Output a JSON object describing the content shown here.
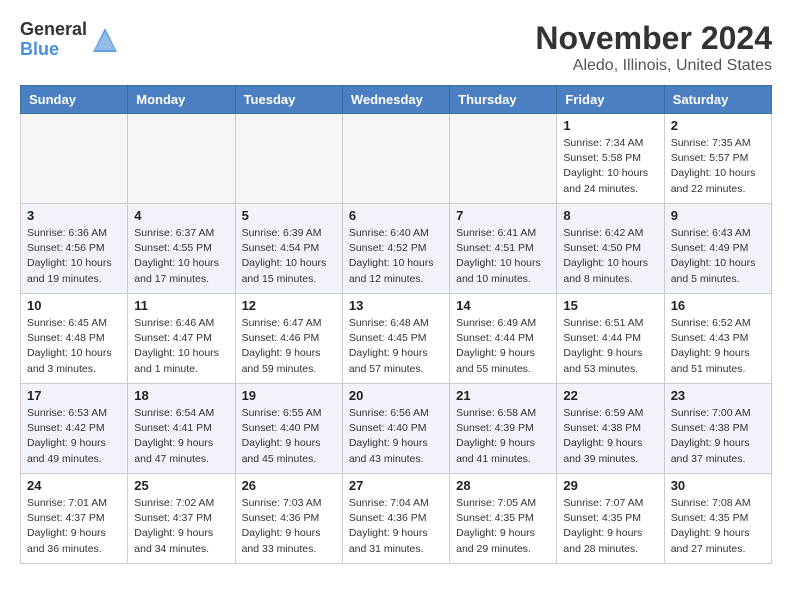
{
  "logo": {
    "text_general": "General",
    "text_blue": "Blue",
    "tagline": "GeneralBlue"
  },
  "header": {
    "month_title": "November 2024",
    "location": "Aledo, Illinois, United States"
  },
  "weekdays": [
    "Sunday",
    "Monday",
    "Tuesday",
    "Wednesday",
    "Thursday",
    "Friday",
    "Saturday"
  ],
  "weeks": [
    [
      {
        "day": "",
        "info": ""
      },
      {
        "day": "",
        "info": ""
      },
      {
        "day": "",
        "info": ""
      },
      {
        "day": "",
        "info": ""
      },
      {
        "day": "",
        "info": ""
      },
      {
        "day": "1",
        "info": "Sunrise: 7:34 AM\nSunset: 5:58 PM\nDaylight: 10 hours\nand 24 minutes."
      },
      {
        "day": "2",
        "info": "Sunrise: 7:35 AM\nSunset: 5:57 PM\nDaylight: 10 hours\nand 22 minutes."
      }
    ],
    [
      {
        "day": "3",
        "info": "Sunrise: 6:36 AM\nSunset: 4:56 PM\nDaylight: 10 hours\nand 19 minutes."
      },
      {
        "day": "4",
        "info": "Sunrise: 6:37 AM\nSunset: 4:55 PM\nDaylight: 10 hours\nand 17 minutes."
      },
      {
        "day": "5",
        "info": "Sunrise: 6:39 AM\nSunset: 4:54 PM\nDaylight: 10 hours\nand 15 minutes."
      },
      {
        "day": "6",
        "info": "Sunrise: 6:40 AM\nSunset: 4:52 PM\nDaylight: 10 hours\nand 12 minutes."
      },
      {
        "day": "7",
        "info": "Sunrise: 6:41 AM\nSunset: 4:51 PM\nDaylight: 10 hours\nand 10 minutes."
      },
      {
        "day": "8",
        "info": "Sunrise: 6:42 AM\nSunset: 4:50 PM\nDaylight: 10 hours\nand 8 minutes."
      },
      {
        "day": "9",
        "info": "Sunrise: 6:43 AM\nSunset: 4:49 PM\nDaylight: 10 hours\nand 5 minutes."
      }
    ],
    [
      {
        "day": "10",
        "info": "Sunrise: 6:45 AM\nSunset: 4:48 PM\nDaylight: 10 hours\nand 3 minutes."
      },
      {
        "day": "11",
        "info": "Sunrise: 6:46 AM\nSunset: 4:47 PM\nDaylight: 10 hours\nand 1 minute."
      },
      {
        "day": "12",
        "info": "Sunrise: 6:47 AM\nSunset: 4:46 PM\nDaylight: 9 hours\nand 59 minutes."
      },
      {
        "day": "13",
        "info": "Sunrise: 6:48 AM\nSunset: 4:45 PM\nDaylight: 9 hours\nand 57 minutes."
      },
      {
        "day": "14",
        "info": "Sunrise: 6:49 AM\nSunset: 4:44 PM\nDaylight: 9 hours\nand 55 minutes."
      },
      {
        "day": "15",
        "info": "Sunrise: 6:51 AM\nSunset: 4:44 PM\nDaylight: 9 hours\nand 53 minutes."
      },
      {
        "day": "16",
        "info": "Sunrise: 6:52 AM\nSunset: 4:43 PM\nDaylight: 9 hours\nand 51 minutes."
      }
    ],
    [
      {
        "day": "17",
        "info": "Sunrise: 6:53 AM\nSunset: 4:42 PM\nDaylight: 9 hours\nand 49 minutes."
      },
      {
        "day": "18",
        "info": "Sunrise: 6:54 AM\nSunset: 4:41 PM\nDaylight: 9 hours\nand 47 minutes."
      },
      {
        "day": "19",
        "info": "Sunrise: 6:55 AM\nSunset: 4:40 PM\nDaylight: 9 hours\nand 45 minutes."
      },
      {
        "day": "20",
        "info": "Sunrise: 6:56 AM\nSunset: 4:40 PM\nDaylight: 9 hours\nand 43 minutes."
      },
      {
        "day": "21",
        "info": "Sunrise: 6:58 AM\nSunset: 4:39 PM\nDaylight: 9 hours\nand 41 minutes."
      },
      {
        "day": "22",
        "info": "Sunrise: 6:59 AM\nSunset: 4:38 PM\nDaylight: 9 hours\nand 39 minutes."
      },
      {
        "day": "23",
        "info": "Sunrise: 7:00 AM\nSunset: 4:38 PM\nDaylight: 9 hours\nand 37 minutes."
      }
    ],
    [
      {
        "day": "24",
        "info": "Sunrise: 7:01 AM\nSunset: 4:37 PM\nDaylight: 9 hours\nand 36 minutes."
      },
      {
        "day": "25",
        "info": "Sunrise: 7:02 AM\nSunset: 4:37 PM\nDaylight: 9 hours\nand 34 minutes."
      },
      {
        "day": "26",
        "info": "Sunrise: 7:03 AM\nSunset: 4:36 PM\nDaylight: 9 hours\nand 33 minutes."
      },
      {
        "day": "27",
        "info": "Sunrise: 7:04 AM\nSunset: 4:36 PM\nDaylight: 9 hours\nand 31 minutes."
      },
      {
        "day": "28",
        "info": "Sunrise: 7:05 AM\nSunset: 4:35 PM\nDaylight: 9 hours\nand 29 minutes."
      },
      {
        "day": "29",
        "info": "Sunrise: 7:07 AM\nSunset: 4:35 PM\nDaylight: 9 hours\nand 28 minutes."
      },
      {
        "day": "30",
        "info": "Sunrise: 7:08 AM\nSunset: 4:35 PM\nDaylight: 9 hours\nand 27 minutes."
      }
    ]
  ]
}
